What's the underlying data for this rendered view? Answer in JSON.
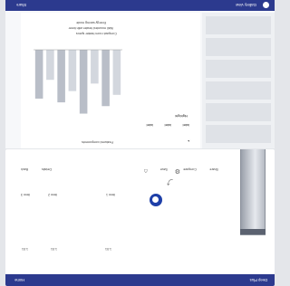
{
  "product": {
    "header_title": "Deep Plus",
    "header_right": "Home",
    "columns": [
      {
        "label": "Item 1",
        "value": "1.01"
      },
      {
        "label": "Item 2",
        "value": "1.01"
      },
      {
        "label": "Item 3",
        "value": "1.01"
      }
    ],
    "actions": [
      "Share",
      "Compare",
      "Save"
    ],
    "toolbar_labels": [
      "Details",
      "Back"
    ]
  },
  "gallery_page": {
    "header_title": "Gallery view",
    "header_right": "Share",
    "spec_lines": [
      "Compact room heater specs",
      "Wall mounted heater with timer",
      "Energy saving mode"
    ],
    "tags": [
      "label",
      "label",
      "label"
    ],
    "highlight": "Highlight",
    "footer_note": "Featured components"
  },
  "colors": {
    "accent": "#2c3a8e",
    "button": "#1e3fa8"
  },
  "chart_data": {
    "type": "bar",
    "categories": [
      "",
      "",
      "",
      "",
      "",
      "",
      "",
      ""
    ],
    "values": [
      60,
      75,
      45,
      85,
      55,
      70,
      40,
      65
    ],
    "ylim": [
      0,
      100
    ]
  }
}
